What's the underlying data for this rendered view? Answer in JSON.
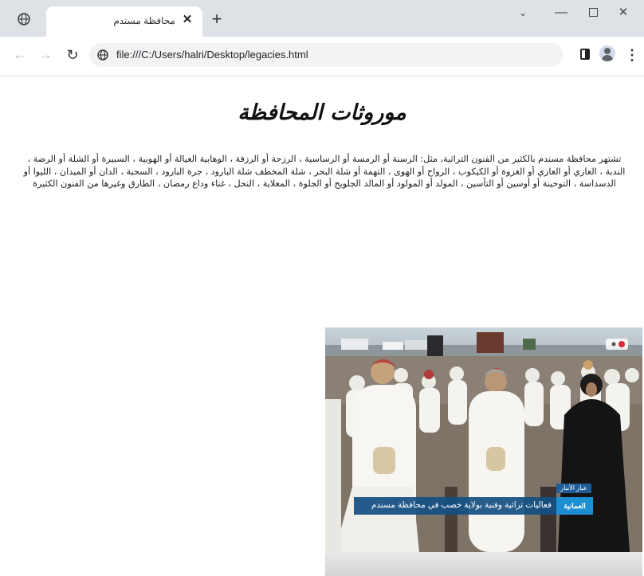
{
  "browser": {
    "tab_title": "محافظة مسندم",
    "tab_close": "✕",
    "new_tab": "+",
    "url": "file:///C:/Users/halri/Desktop/legacies.html",
    "window_controls": {
      "chevron": "⌄",
      "minimize": "—",
      "close": "✕"
    },
    "nav": {
      "back": "←",
      "forward": "→",
      "reload": "↻"
    },
    "menu": "⋮",
    "icons": [
      "globe-icon",
      "close-icon",
      "plus-icon",
      "chevron-down-icon",
      "minimize-icon",
      "maximize-icon",
      "back-arrow-icon",
      "forward-arrow-icon",
      "reload-icon",
      "site-info-icon",
      "side-panel-icon",
      "profile-icon",
      "kebab-menu-icon"
    ]
  },
  "page": {
    "heading": "موروثات المحافظة",
    "paragraph": "تشتهر محافظة مسندم بالكثير من الفنون التراثية، مثل: الرسنة أو الرمسة أو الرساسية ، الرزحة أو الرزفة ، الوهابية العيالة أو الهوبية ، السبيرة أو الشلة أو الرضة ، الندبة ، العازي أو العازي أو الغزوة أو الكيكوب ، الرواح أو الهوى ، التهمة أو شلة البحر ، شلة المخطف شلة البارود ، جرة البارود ، السحبة ، الدان أو الميدان ، الليوا أو الدسداسة ، التوحينة أو أوسين أو التأسين ، المولد أو المولود أو المالد الجلويح أو الجلوة ، المعلاية ، النحل ، غناء وداع رمضان ، الطارق وغيرها من الفنون الكثيرة",
    "photo": {
      "news_tag": "عبار الأنبار",
      "news_logo": "العمانية",
      "news_caption": "فعاليات تراثية وفنية بولاية خصب في محافظة مسندم"
    }
  }
}
